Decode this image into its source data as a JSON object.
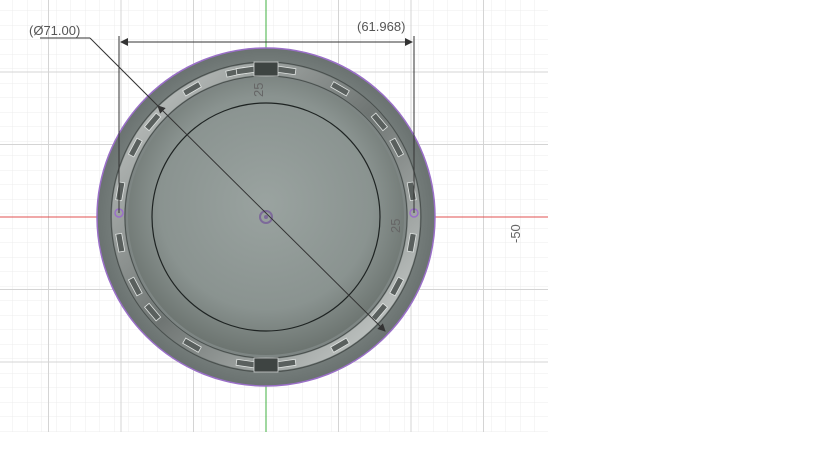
{
  "dimensions": {
    "diameter_label": "(Ø71.00)",
    "width_label": "(61.968)"
  },
  "axis_labels": {
    "y_neg_50": "-50",
    "top_25": "25",
    "right_25": "25"
  },
  "colors": {
    "x_axis": "#e05050",
    "y_axis": "#40b040",
    "grid_minor": "#e8e8e8",
    "grid_major": "#d0d0d0",
    "part_outline": "#9a6fc8",
    "dimension_line": "#333333"
  }
}
